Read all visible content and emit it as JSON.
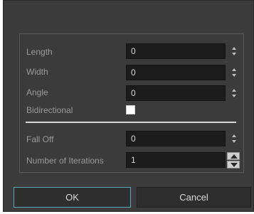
{
  "form": {
    "rows": [
      {
        "label": "Length",
        "value": "0"
      },
      {
        "label": "Width",
        "value": "0"
      },
      {
        "label": "Angle",
        "value": "0"
      }
    ],
    "bidirectional": {
      "label": "Bidirectional",
      "checked": false
    },
    "fall_off": {
      "label": "Fall Off",
      "value": "0"
    },
    "iterations": {
      "label": "Number of Iterations",
      "value": "1"
    }
  },
  "buttons": {
    "ok_label": "OK",
    "cancel_label": "Cancel"
  },
  "colors": {
    "background": "#3b3b3b",
    "field_background": "#1b1b1b",
    "accent_focus": "#5aa9b8"
  },
  "icons": {
    "spin": "spin-arrows-icon",
    "stepper_up": "triangle-up-icon",
    "stepper_down": "triangle-down-icon"
  }
}
